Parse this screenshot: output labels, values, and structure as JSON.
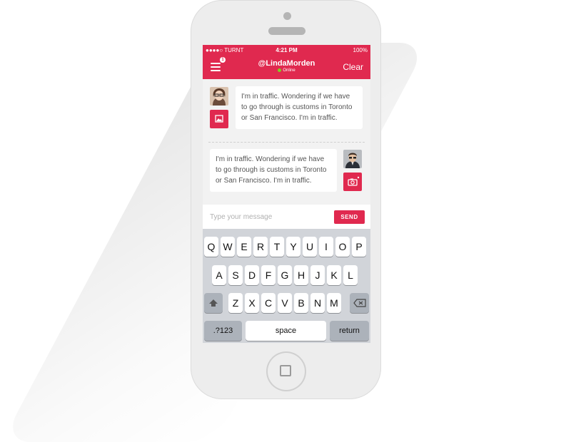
{
  "status": {
    "carrier": "●●●●○ TURNT",
    "time": "4:21 PM",
    "battery": "100%"
  },
  "header": {
    "title": "@LindaMorden",
    "status": "Online",
    "clear_label": "Clear",
    "menu_badge": "1",
    "accent": "#e0294f"
  },
  "messages": [
    {
      "text": "I'm in traffic. Wondering if we have\nto go through is customs in Toronto\nor San Francisco. I'm in traffic.",
      "side": "left",
      "action_icon": "image-icon"
    },
    {
      "text": "I'm in traffic. Wondering if we have\nto go through is customs in Toronto\nor San Francisco. I'm in traffic.",
      "side": "right",
      "action_icon": "camera-icon"
    }
  ],
  "composer": {
    "placeholder": "Type your message",
    "send_label": "SEND"
  },
  "keyboard": {
    "row1": [
      "Q",
      "W",
      "E",
      "R",
      "T",
      "Y",
      "U",
      "I",
      "O",
      "P"
    ],
    "row2": [
      "A",
      "S",
      "D",
      "F",
      "G",
      "H",
      "J",
      "K",
      "L"
    ],
    "row3": [
      "Z",
      "X",
      "C",
      "V",
      "B",
      "N",
      "M"
    ],
    "numbers_label": ".?123",
    "space_label": "space",
    "return_label": "return"
  }
}
